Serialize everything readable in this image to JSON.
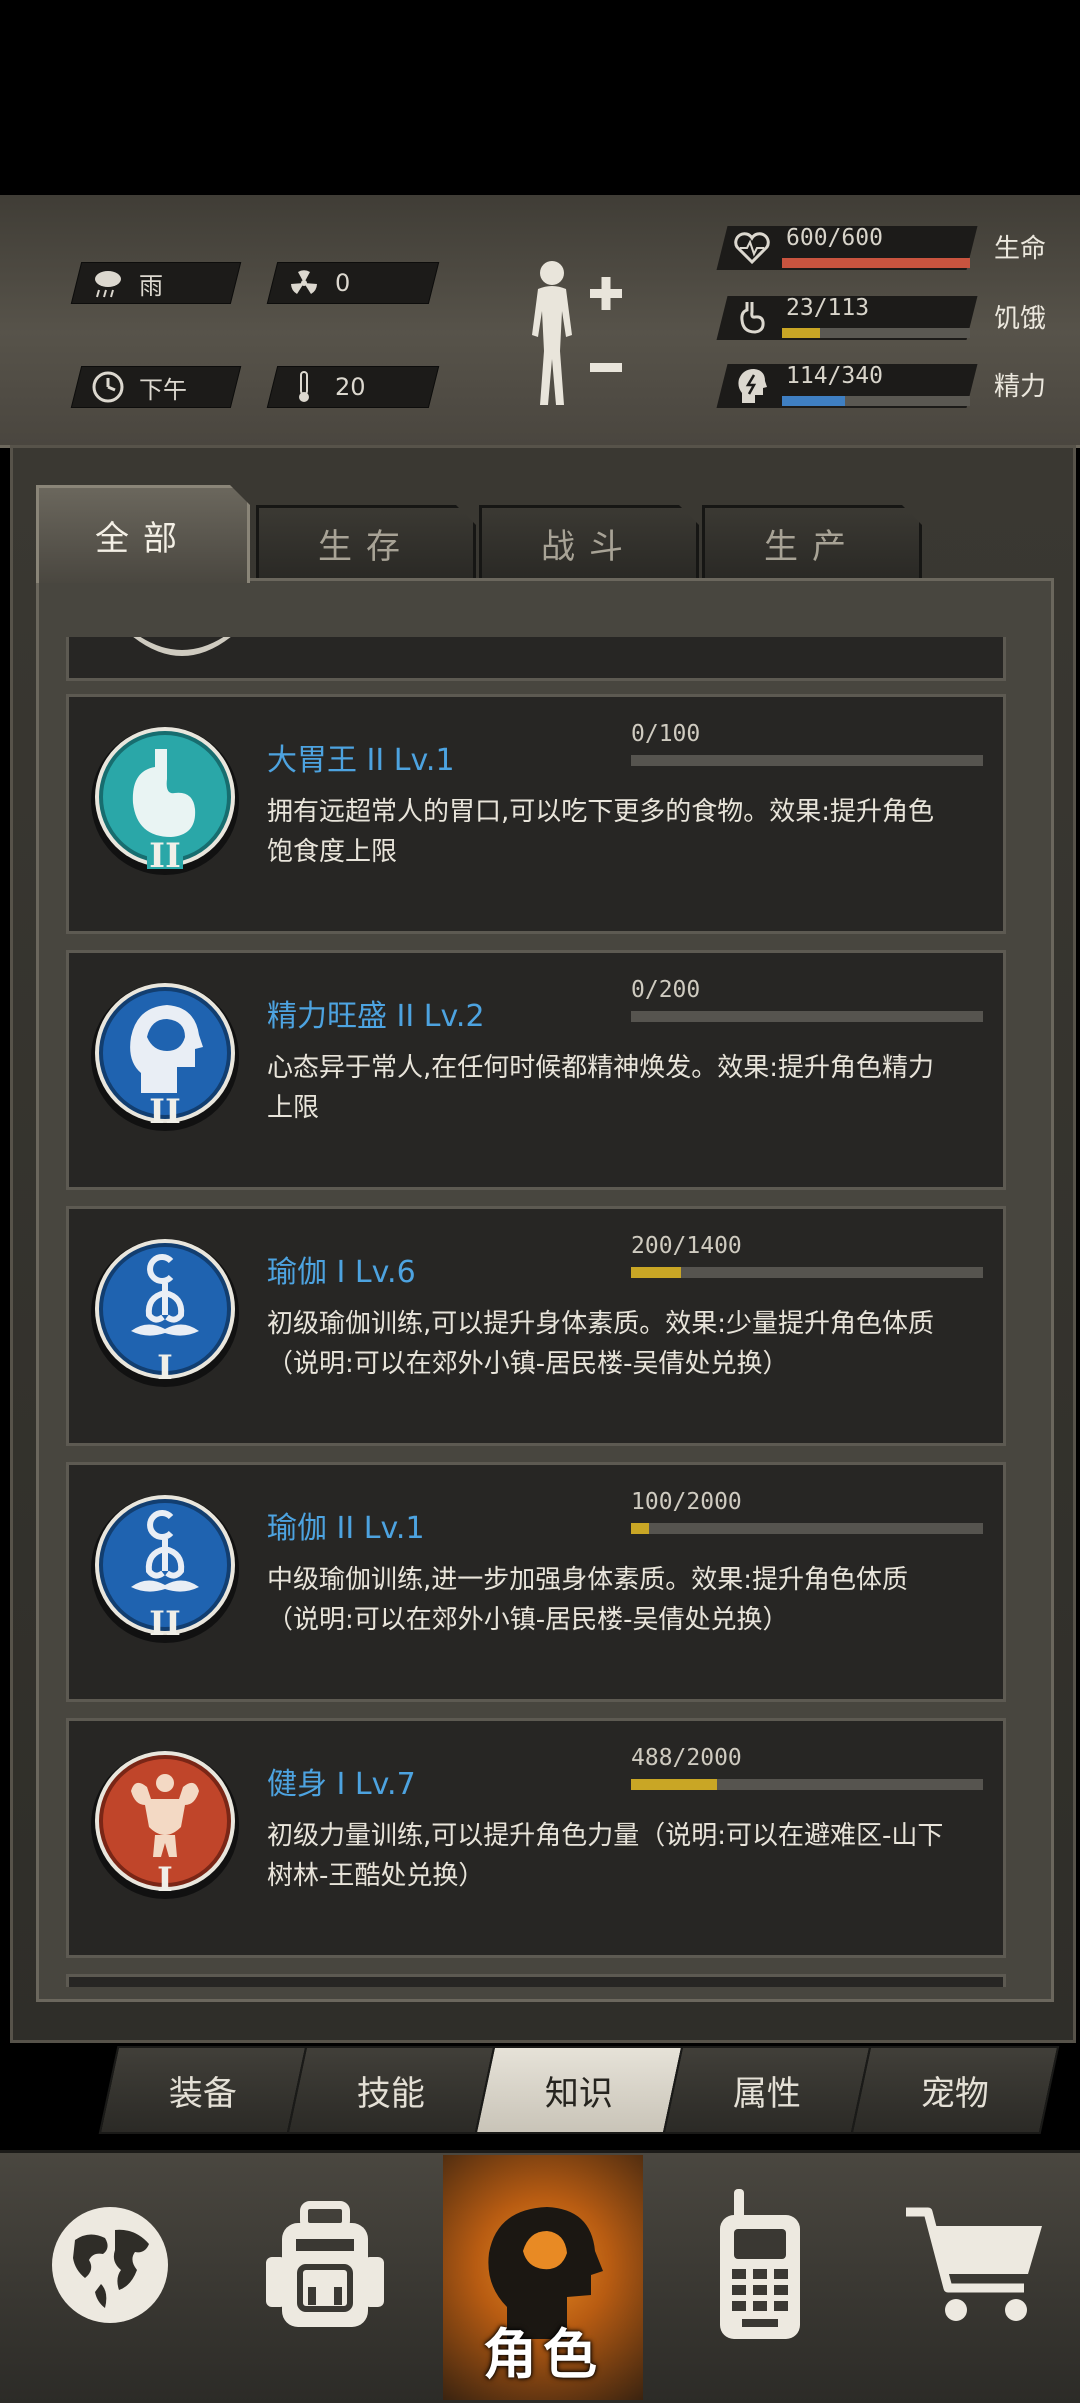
{
  "status": {
    "weather": "雨",
    "radiation": "0",
    "time_of_day": "下午",
    "temperature": "20",
    "health_value": "600/600",
    "health_label": "生命",
    "health_fraction": 1.0,
    "hunger_value": "23/113",
    "hunger_label": "饥饿",
    "hunger_fraction": 0.2,
    "energy_value": "114/340",
    "energy_label": "精力",
    "energy_fraction": 0.335,
    "colors": {
      "health": "#c9543f",
      "hunger": "#c9a625",
      "energy": "#3f7fc2"
    }
  },
  "tabs": [
    "全部",
    "生存",
    "战斗",
    "生产"
  ],
  "active_tab": "全部",
  "skills": [
    {
      "title": "大胃王 II Lv.1",
      "progress_text": "0/100",
      "progress_fraction": 0.0,
      "description": "拥有远超常人的胃口,可以吃下更多的食物。效果:提升角色饱食度上限",
      "icon": "stomach-icon",
      "icon_color": "#2aa7a8",
      "rank": "II"
    },
    {
      "title": "精力旺盛 II Lv.2",
      "progress_text": "0/200",
      "progress_fraction": 0.0,
      "description": "心态异于常人,在任何时候都精神焕发。效果:提升角色精力上限",
      "icon": "head-icon",
      "icon_color": "#1f63b0",
      "rank": "II"
    },
    {
      "title": "瑜伽 I Lv.6",
      "progress_text": "200/1400",
      "progress_fraction": 0.143,
      "description": "初级瑜伽训练,可以提升身体素质。效果:少量提升角色体质（说明:可以在郊外小镇-居民楼-吴倩处兑换）",
      "icon": "yoga-icon",
      "icon_color": "#1f63b0",
      "rank": "I"
    },
    {
      "title": "瑜伽 II Lv.1",
      "progress_text": "100/2000",
      "progress_fraction": 0.05,
      "description": "中级瑜伽训练,进一步加强身体素质。效果:提升角色体质（说明:可以在郊外小镇-居民楼-吴倩处兑换）",
      "icon": "yoga-icon",
      "icon_color": "#1f63b0",
      "rank": "II"
    },
    {
      "title": "健身 I Lv.7",
      "progress_text": "488/2000",
      "progress_fraction": 0.244,
      "description": "初级力量训练,可以提升角色力量（说明:可以在避难区-山下树林-王酷处兑换）",
      "icon": "muscle-icon",
      "icon_color": "#c0452a",
      "rank": "I"
    }
  ],
  "subtabs": [
    "装备",
    "技能",
    "知识",
    "属性",
    "宠物"
  ],
  "active_subtab": "知识",
  "nav": {
    "items": [
      "globe-icon",
      "backpack-icon",
      "character-icon",
      "walkie-talkie-icon",
      "shopping-cart-icon"
    ],
    "active_label": "角色"
  }
}
